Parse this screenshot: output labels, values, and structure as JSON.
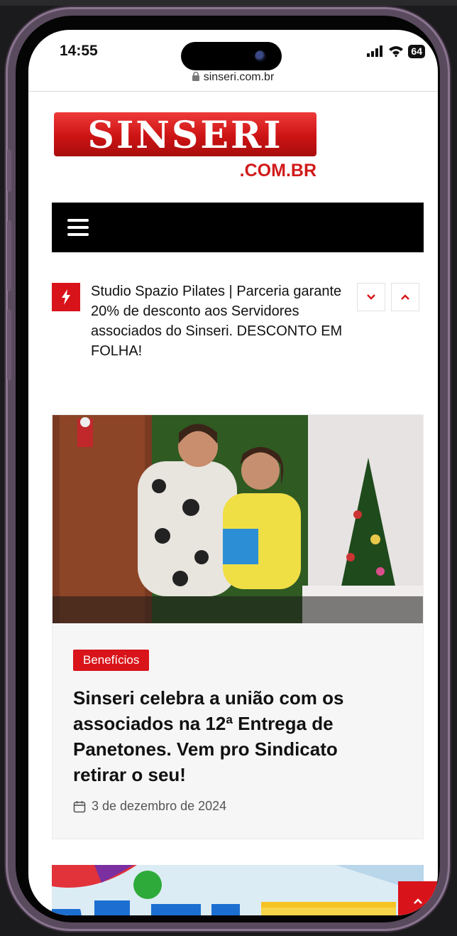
{
  "status": {
    "time": "14:55",
    "battery": "64"
  },
  "browser": {
    "url": "sinseri.com.br"
  },
  "logo": {
    "main": "SINSERI",
    "sub": ".COM.BR"
  },
  "ticker": {
    "text": "Studio Spazio Pilates | Parceria garante 20% de desconto aos Servidores associados do Sinseri. DESCONTO EM FOLHA!"
  },
  "post": {
    "category": "Benefícios",
    "title": "Sinseri celebra a união com os associados na 12ª Entrega de Panetones. Vem pro Sindicato retirar o seu!",
    "date": "3 de dezembro de 2024"
  },
  "colors": {
    "accent": "#d8141a",
    "nav": "#000000"
  },
  "icons": [
    "signal-icon",
    "wifi-icon",
    "lock-icon",
    "menu-icon",
    "flash-icon",
    "chevron-down-icon",
    "chevron-up-icon",
    "calendar-icon",
    "arrow-up-icon"
  ]
}
